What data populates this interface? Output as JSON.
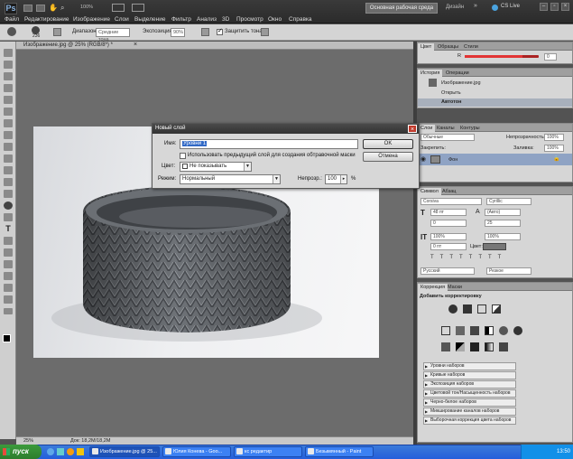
{
  "app": {
    "logo": "Ps",
    "menu": [
      "Файл",
      "Редактирование",
      "Изображение",
      "Слои",
      "Выделение",
      "Фильтр",
      "Анализ",
      "3D",
      "Просмотр",
      "Окно",
      "Справка"
    ],
    "zoom_combo": "100%",
    "workspace_button": "Основная рабочая среда",
    "design_label": "Дизайн",
    "cs_live": "CS Live"
  },
  "options_bar": {
    "brush_size": "236",
    "range_label": "Диапазон:",
    "range_value": "Средние тона",
    "exposure_label": "Экспозиция:",
    "exposure_value": "90%",
    "protect_tones": "Защитить тона"
  },
  "document": {
    "tab_title": "Изображение.jpg @ 25% (RGB/8*) *",
    "zoom": "25%",
    "doc_info": "Док: 18,2M/18,2M"
  },
  "dialog": {
    "title": "Новый слой",
    "name_label": "Имя:",
    "name_value": "Уровни 1",
    "ok_label": "OK",
    "cancel_label": "Отмена",
    "use_prev_mask_label": "Использовать предыдущий слой для создания обтравочной маски",
    "color_label": "Цвет:",
    "color_value": "Не показывать",
    "mode_label": "Режим:",
    "mode_value": "Нормальный",
    "opacity_label": "Непрозр.:",
    "opacity_value": "100",
    "opacity_unit": "%"
  },
  "color_panel": {
    "tabs": [
      "Цвет",
      "Образцы",
      "Стили"
    ],
    "channel_label": "R",
    "channel_value": "0",
    "channel_fill": 0.78
  },
  "history_panel": {
    "tabs": [
      "История",
      "Операции"
    ],
    "snapshot": "Изображение.jpg",
    "items": [
      "Открыть",
      "Автотон"
    ]
  },
  "layers_panel": {
    "tabs": [
      "Слои",
      "Каналы",
      "Контуры"
    ],
    "blend": "Обычные",
    "opacity_label": "Непрозрачность:",
    "opacity": "100%",
    "lock_label": "Закрепить:",
    "fill_label": "Заливка:",
    "fill": "100%",
    "layer_name": "Фон"
  },
  "char_panel": {
    "tabs": [
      "Символ",
      "Абзац"
    ],
    "font": "Corsiva",
    "style": "Cyrillic",
    "size": "48 пт",
    "leading": "(Авто)",
    "kerning": "0",
    "tracking": "25",
    "vscale": "100%",
    "hscale": "100%",
    "baseline": "0 пт",
    "color_label": "Цвет:",
    "language": "Русский",
    "aa": "Резкое"
  },
  "adjustments_panel": {
    "tabs": [
      "Коррекция",
      "Маски"
    ],
    "header": "Добавить корректировку",
    "presets": [
      "Уровни наборов",
      "Кривые наборов",
      "Экспозиция наборов",
      "Цветовой тон/Насыщенность наборов",
      "Черно-белое наборов",
      "Микширование каналов наборов",
      "Выборочная коррекция цвета наборов"
    ]
  },
  "taskbar": {
    "start": "пуск",
    "tasks": [
      "Изображение.jpg @ 25...",
      "Юлия Конева - Goo...",
      "кс редактир",
      "Безымянный - Paint"
    ],
    "time": "13:50"
  },
  "colors": {
    "chrome_dark": "#2b2b2b",
    "dialog_bg": "#d7d7d7",
    "taskbar_blue": "#245edb",
    "start_green": "#2d7d2d",
    "bracelet": "#6f7378"
  }
}
